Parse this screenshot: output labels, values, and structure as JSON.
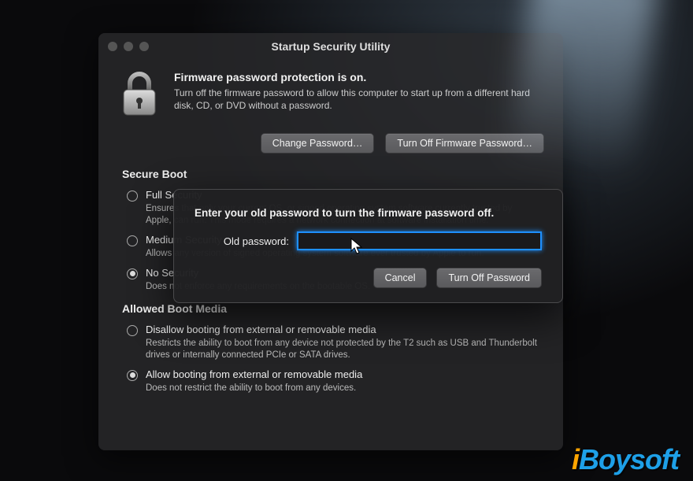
{
  "window": {
    "title": "Startup Security Utility",
    "header_title": "Firmware password protection is on.",
    "header_desc": "Turn off the firmware password to allow this computer to start up from a different hard disk, CD, or DVD without a password.",
    "change_btn": "Change Password…",
    "turnoff_btn": "Turn Off Firmware Password…"
  },
  "secure_boot": {
    "heading": "Secure Boot",
    "options": [
      {
        "title": "Full Security",
        "desc": "Ensures that only your current OS, or signed operating system software currently trusted by Apple, can run. This mode requires a network connection at software installation time."
      },
      {
        "title": "Medium Security",
        "desc": "Allows any version of signed operating system software ever trusted by Apple to run."
      },
      {
        "title": "No Security",
        "desc": "Does not enforce any requirements on the bootable OS."
      }
    ],
    "selected": 2
  },
  "boot_media": {
    "heading": "Allowed Boot Media",
    "options": [
      {
        "title": "Disallow booting from external or removable media",
        "desc": "Restricts the ability to boot from any device not protected by the T2 such as USB and Thunderbolt drives or internally connected PCIe or SATA drives."
      },
      {
        "title": "Allow booting from external or removable media",
        "desc": "Does not restrict the ability to boot from any devices."
      }
    ],
    "selected": 1
  },
  "sheet": {
    "title": "Enter your old password to turn the firmware password off.",
    "label": "Old password:",
    "value": "",
    "cancel": "Cancel",
    "confirm": "Turn Off Password"
  },
  "watermark": "iBoysoft"
}
